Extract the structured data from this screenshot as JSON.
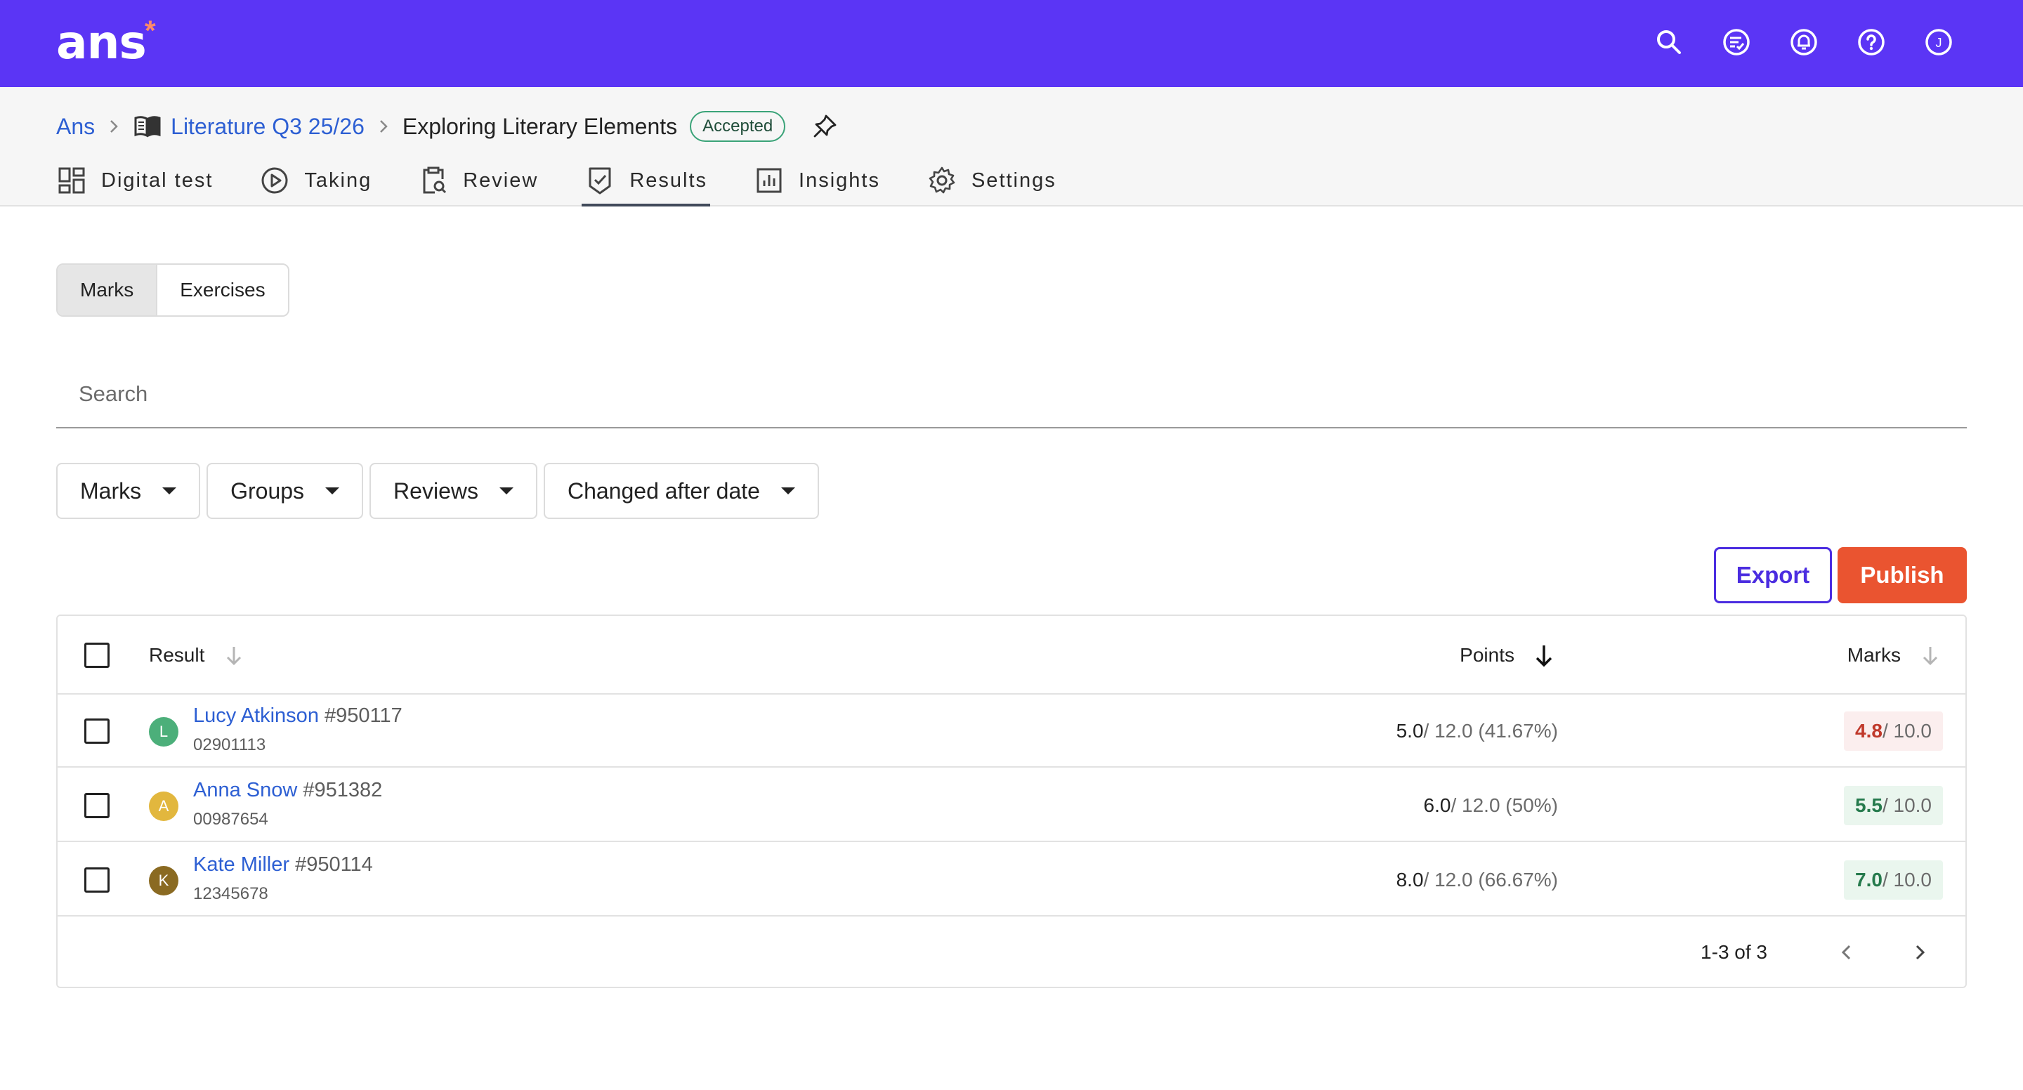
{
  "app": {
    "logo": "ans",
    "logo_mark": "*"
  },
  "topbar": {
    "icons": [
      "search-icon",
      "checklist-icon",
      "notifications-icon",
      "help-icon",
      "user-avatar"
    ],
    "user_initial": "J"
  },
  "breadcrumb": {
    "root": "Ans",
    "course": "Literature Q3 25/26",
    "current": "Exploring Literary Elements",
    "status_badge": "Accepted"
  },
  "tabs": [
    {
      "label": "Digital test",
      "icon": "dashboard-icon"
    },
    {
      "label": "Taking",
      "icon": "play-icon"
    },
    {
      "label": "Review",
      "icon": "clipboard-search-icon"
    },
    {
      "label": "Results",
      "icon": "shield-check-icon",
      "active": true
    },
    {
      "label": "Insights",
      "icon": "bar-chart-icon"
    },
    {
      "label": "Settings",
      "icon": "gear-icon"
    }
  ],
  "segmented": {
    "marks": "Marks",
    "exercises": "Exercises",
    "active": "Marks"
  },
  "search": {
    "placeholder": "Search",
    "value": ""
  },
  "filters": {
    "marks": "Marks",
    "groups": "Groups",
    "reviews": "Reviews",
    "changed_after": "Changed after date"
  },
  "actions": {
    "export": "Export",
    "publish": "Publish"
  },
  "table": {
    "headers": {
      "result": "Result",
      "points": "Points",
      "marks": "Marks"
    },
    "rows": [
      {
        "initial": "L",
        "avatar_color": "#4caf7a",
        "name": "Lucy Atkinson",
        "id": "#950117",
        "student_number": "02901113",
        "points": "5.0",
        "points_rest": " / 12.0 (41.67%)",
        "mark": "4.8",
        "mark_rest": " / 10.0",
        "mark_color": "#c0392b",
        "mark_bg": "#fbeeee"
      },
      {
        "initial": "A",
        "avatar_color": "#e2b73e",
        "name": "Anna Snow",
        "id": "#951382",
        "student_number": "00987654",
        "points": "6.0",
        "points_rest": " / 12.0 (50%)",
        "mark": "5.5",
        "mark_rest": " / 10.0",
        "mark_color": "#257a4c",
        "mark_bg": "#eaf6ee"
      },
      {
        "initial": "K",
        "avatar_color": "#8a6a22",
        "name": "Kate Miller",
        "id": "#950114",
        "student_number": "12345678",
        "points": "8.0",
        "points_rest": " / 12.0 (66.67%)",
        "mark": "7.0",
        "mark_rest": " / 10.0",
        "mark_color": "#257a4c",
        "mark_bg": "#eaf6ee"
      }
    ],
    "pagination": "1-3 of 3"
  },
  "colors": {
    "topbar": "#5b35f5",
    "link": "#2d5fd3",
    "publish": "#ea5430",
    "export": "#4b2de0"
  }
}
